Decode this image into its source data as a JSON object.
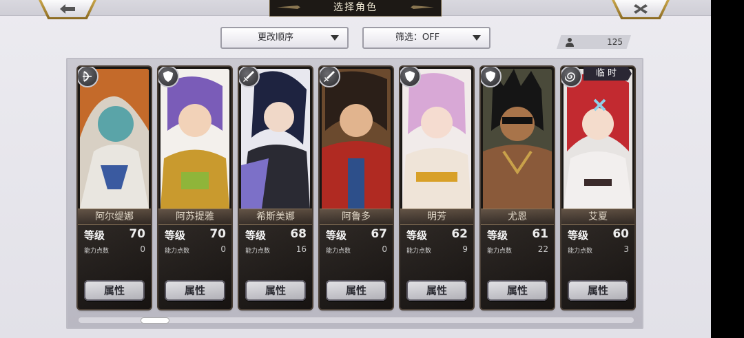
{
  "header": {
    "title": "选择角色"
  },
  "nav": {
    "back_icon": "back-arrow-icon",
    "close_icon": "close-icon"
  },
  "toolbar": {
    "sort_label": "更改顺序",
    "filter_label": "筛选：OFF",
    "count": "125",
    "count_icon": "person-icon"
  },
  "colors": {
    "accent_gold": "#b89a4e",
    "card_bg": "#1a1714",
    "panel": "#bebdc6"
  },
  "characters": [
    {
      "name": "阿尔缇娜",
      "level_label": "等级",
      "level": "70",
      "ap_label": "能力点数",
      "ap": "0",
      "attr_label": "属性",
      "class_icon": "bow-icon"
    },
    {
      "name": "阿苏提雅",
      "level_label": "等级",
      "level": "70",
      "ap_label": "能力点数",
      "ap": "0",
      "attr_label": "属性",
      "class_icon": "shield-icon"
    },
    {
      "name": "希斯美娜",
      "level_label": "等级",
      "level": "68",
      "ap_label": "能力点数",
      "ap": "16",
      "attr_label": "属性",
      "class_icon": "sword-icon"
    },
    {
      "name": "阿鲁多",
      "level_label": "等级",
      "level": "67",
      "ap_label": "能力点数",
      "ap": "0",
      "attr_label": "属性",
      "class_icon": "sword-icon"
    },
    {
      "name": "明芳",
      "level_label": "等级",
      "level": "62",
      "ap_label": "能力点数",
      "ap": "9",
      "attr_label": "属性",
      "class_icon": "shield-icon"
    },
    {
      "name": "尤恩",
      "level_label": "等级",
      "level": "61",
      "ap_label": "能力点数",
      "ap": "22",
      "attr_label": "属性",
      "class_icon": "shield-icon"
    },
    {
      "name": "艾夏",
      "level_label": "等级",
      "level": "60",
      "ap_label": "能力点数",
      "ap": "3",
      "attr_label": "属性",
      "class_icon": "spiral-icon",
      "badge": "临时"
    }
  ]
}
